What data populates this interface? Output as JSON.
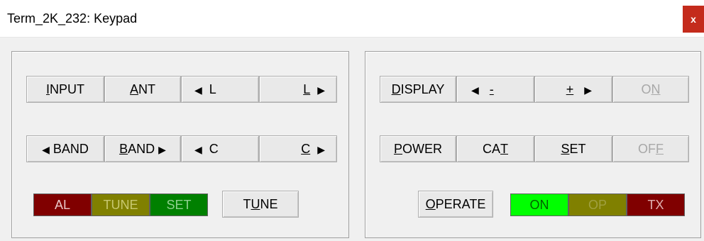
{
  "window": {
    "title": "Term_2K_232: Keypad",
    "close_glyph": "x"
  },
  "left": {
    "row1": {
      "input": {
        "u": "I",
        "rest": "NPUT"
      },
      "ant": {
        "u": "A",
        "rest": "NT"
      },
      "l_left": {
        "arrow": "◀",
        "text": "L"
      },
      "l_right": {
        "u": "L",
        "arrow": "▶"
      }
    },
    "row2": {
      "band_left": {
        "arrow": "◀",
        "text": "BAND"
      },
      "band_right": {
        "u": "B",
        "rest": "AND",
        "arrow": "▶"
      },
      "c_left": {
        "arrow": "◀",
        "text": "C"
      },
      "c_right": {
        "u": "C",
        "arrow": "▶"
      }
    },
    "indicators": [
      {
        "label": "AL",
        "bg": "#800000",
        "fg": "#e8c8c8"
      },
      {
        "label": "TUNE",
        "bg": "#808000",
        "fg": "#c8c870"
      },
      {
        "label": "SET",
        "bg": "#008000",
        "fg": "#90d090"
      }
    ],
    "tune_button": {
      "pre": "T",
      "u": "U",
      "rest": "NE"
    }
  },
  "right": {
    "row1": {
      "display": {
        "u": "D",
        "rest": "ISPLAY"
      },
      "minus": {
        "arrow": "◀",
        "text": "-"
      },
      "plus": {
        "text": "+",
        "arrow": "▶"
      },
      "on": {
        "pre": "O",
        "u": "N"
      }
    },
    "row2": {
      "power": {
        "u": "P",
        "rest": "OWER"
      },
      "cat": {
        "pre": "CA",
        "u": "T"
      },
      "set": {
        "u": "S",
        "rest": "ET"
      },
      "off": {
        "pre": "OF",
        "u": "F"
      }
    },
    "operate": {
      "u": "O",
      "rest": "PERATE"
    },
    "indicators": [
      {
        "label": "ON",
        "bg": "#00ff00",
        "fg": "#006000"
      },
      {
        "label": "OP",
        "bg": "#808000",
        "fg": "#a0a040"
      },
      {
        "label": "TX",
        "bg": "#800000",
        "fg": "#e0b0b0"
      }
    ]
  }
}
